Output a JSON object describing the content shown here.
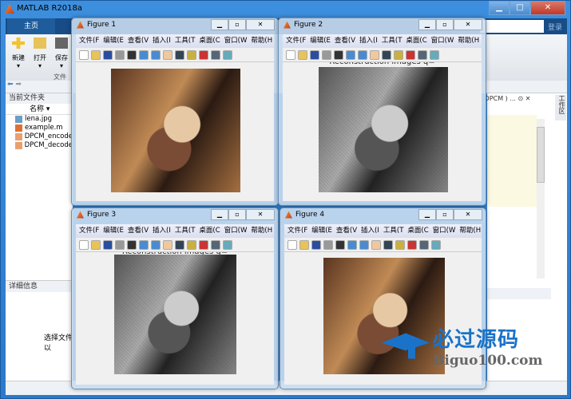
{
  "app": {
    "title": "MATLAB R2018a",
    "login": "登录"
  },
  "tabs": {
    "home": "主页"
  },
  "ribbon": {
    "new": "新建",
    "open": "打开",
    "save": "保存",
    "group": "文件"
  },
  "browser": {
    "header": "当前文件夹",
    "column": "名称 ▾",
    "files": [
      "lena.jpg",
      "example.m",
      "DPCM_encode",
      "DPCM_decode"
    ]
  },
  "details": {
    "header": "详细信息",
    "select": "选择文件以"
  },
  "editor": {
    "tab": "( DPCM ) ...",
    "workspace": "工作区"
  },
  "figure_menu": [
    "文件(F",
    "编辑(E",
    "查看(V",
    "插入(I",
    "工具(T",
    "桌面(C",
    "窗口(W",
    "帮助(H"
  ],
  "figures": [
    {
      "title": "Figure 1",
      "plot_title": "",
      "style": "color"
    },
    {
      "title": "Figure 2",
      "plot_title": "Reconstruction images q=",
      "style": "gray"
    },
    {
      "title": "Figure 3",
      "plot_title": "Reconstruction images q=",
      "style": "gray"
    },
    {
      "title": "Figure 4",
      "plot_title": "",
      "style": "color"
    }
  ],
  "watermark": {
    "cn": "必过源码",
    "en": "Biguo100.com"
  }
}
